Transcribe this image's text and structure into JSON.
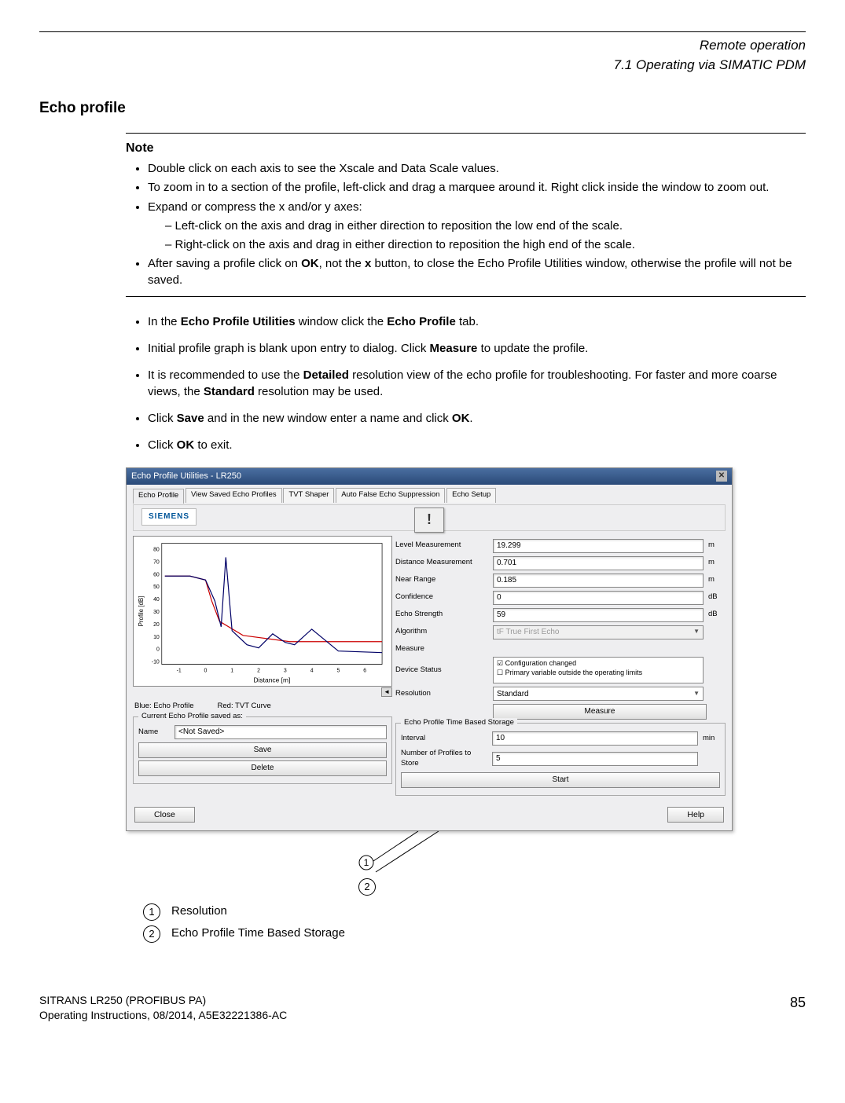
{
  "header": {
    "chapter": "Remote operation",
    "section": "7.1 Operating via SIMATIC PDM"
  },
  "section_title": "Echo profile",
  "note": {
    "label": "Note",
    "b1": "Double click on each axis to see the Xscale and Data Scale values.",
    "b2": "To zoom in to a section of the profile, left-click and drag a marquee around it. Right click inside the window to zoom out.",
    "b3": "Expand or compress the x and/or y axes:",
    "b3a": "Left-click on the axis and drag in either direction to reposition the low end of the scale.",
    "b3b": "Right-click on the axis and drag in either direction to reposition the high end of the scale.",
    "b4_pre": "After saving a profile click on ",
    "b4_bold1": "OK",
    "b4_mid": ", not the ",
    "b4_bold2": "x",
    "b4_post": " button, to close the Echo Profile Utilities window, otherwise the profile will not be saved."
  },
  "steps": {
    "s1_pre": "In the ",
    "s1_b1": "Echo Profile Utilities",
    "s1_mid": " window click the ",
    "s1_b2": "Echo Profile",
    "s1_post": " tab.",
    "s2_pre": "Initial profile graph is blank upon entry to dialog. Click ",
    "s2_b": "Measure",
    "s2_post": " to update the profile.",
    "s3_pre": "It is recommended to use the ",
    "s3_b1": "Detailed",
    "s3_mid": " resolution view of the echo profile for troubleshooting. For faster and more coarse views, the ",
    "s3_b2": "Standard",
    "s3_post": " resolution may be used.",
    "s4_pre": "Click ",
    "s4_b1": "Save",
    "s4_mid": " and in the new window enter a name and click ",
    "s4_b2": "OK",
    "s4_post": ".",
    "s5_pre": "Click ",
    "s5_b": "OK",
    "s5_post": " to exit."
  },
  "window": {
    "title": "Echo Profile Utilities - LR250",
    "tabs": [
      "Echo Profile",
      "View Saved Echo Profiles",
      "TVT Shaper",
      "Auto False Echo Suppression",
      "Echo Setup"
    ],
    "logo": "SIEMENS",
    "chart": {
      "y_label": "Profile [dB]",
      "x_label": "Distance [m]",
      "y_ticks": [
        "-10",
        "0",
        "10",
        "20",
        "30",
        "40",
        "50",
        "60",
        "70",
        "80"
      ],
      "x_ticks": [
        "-1",
        "0",
        "1",
        "2",
        "3",
        "4",
        "5",
        "6"
      ]
    },
    "legend_blue": "Blue: Echo Profile",
    "legend_red": "Red: TVT Curve",
    "readings": {
      "level": {
        "label": "Level Measurement",
        "value": "19.299",
        "unit": "m"
      },
      "distance": {
        "label": "Distance Measurement",
        "value": "0.701",
        "unit": "m"
      },
      "near": {
        "label": "Near Range",
        "value": "0.185",
        "unit": "m"
      },
      "conf": {
        "label": "Confidence",
        "value": "0",
        "unit": "dB"
      },
      "echo": {
        "label": "Echo Strength",
        "value": "59",
        "unit": "dB"
      },
      "algo": {
        "label": "Algorithm",
        "value": "tF   True First Echo"
      }
    },
    "measure_group": "Measure",
    "device_status": {
      "label": "Device Status",
      "line1": "Configuration changed",
      "line2": "Primary variable outside the operating limits"
    },
    "resolution": {
      "label": "Resolution",
      "value": "Standard"
    },
    "measure_btn": "Measure",
    "saved_group": {
      "title": "Current Echo Profile saved as:",
      "name_label": "Name",
      "name_value": "<Not Saved>",
      "save_btn": "Save",
      "delete_btn": "Delete"
    },
    "storage_group": {
      "title": "Echo Profile Time Based Storage",
      "interval_label": "Interval",
      "interval_value": "10",
      "interval_unit": "min",
      "count_label": "Number of Profiles to Store",
      "count_value": "5",
      "start_btn": "Start"
    },
    "close_btn": "Close",
    "help_btn": "Help",
    "status_icon": "!"
  },
  "callouts": {
    "c1_num": "1",
    "c1": "Resolution",
    "c2_num": "2",
    "c2": "Echo Profile Time Based Storage"
  },
  "footer": {
    "line1": "SITRANS LR250 (PROFIBUS PA)",
    "line2": "Operating Instructions, 08/2014, A5E32221386-AC",
    "page": "85"
  },
  "chart_data": {
    "type": "line",
    "xlabel": "Distance [m]",
    "ylabel": "Profile [dB]",
    "xlim": [
      -1.5,
      6.8
    ],
    "ylim": [
      -12,
      82
    ],
    "series": [
      {
        "name": "TVT Curve (red)",
        "x": [
          -1.5,
          -0.5,
          0,
          0.2,
          0.5,
          1.5,
          3,
          6.8
        ],
        "y": [
          60,
          60,
          55,
          40,
          25,
          15,
          10,
          10
        ]
      },
      {
        "name": "Echo Profile (blue)",
        "x": [
          -1.5,
          -0.5,
          0,
          0.3,
          0.5,
          0.7,
          0.9,
          1.5,
          2.0,
          2.5,
          3.0,
          3.5,
          4.0,
          5.0,
          6.8
        ],
        "y": [
          60,
          60,
          55,
          40,
          20,
          75,
          18,
          5,
          2,
          12,
          6,
          4,
          16,
          0,
          -2
        ]
      }
    ]
  }
}
